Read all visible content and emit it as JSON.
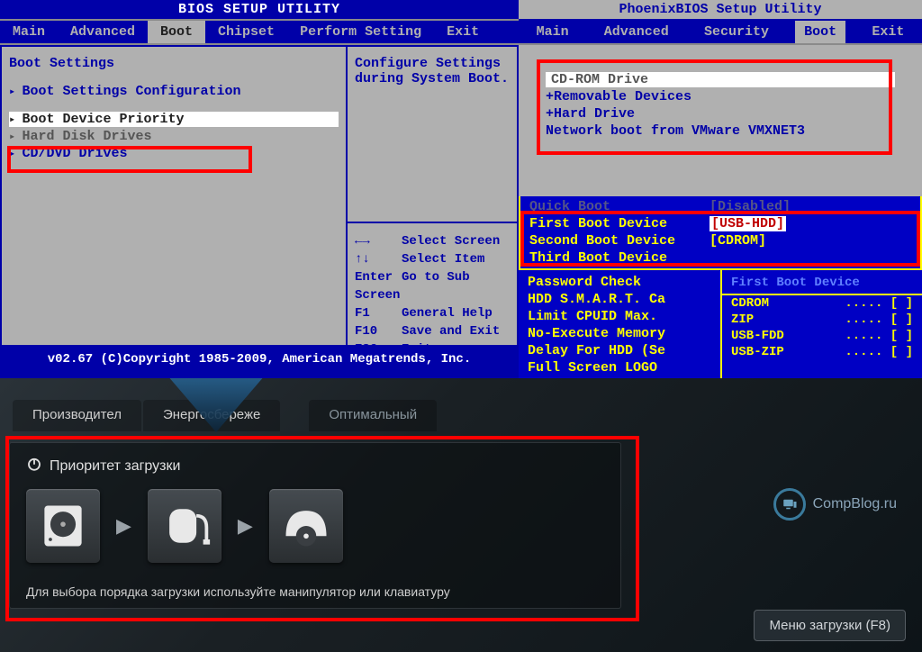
{
  "ami": {
    "title": "BIOS SETUP UTILITY",
    "menubar": [
      "Main",
      "Advanced",
      "Boot",
      "Chipset",
      "Perform Setting",
      "Exit"
    ],
    "selected_menu": 2,
    "panel_title": "Boot Settings",
    "items": [
      {
        "label": "Boot Settings Configuration",
        "sel": false
      },
      {
        "label": "Boot Device Priority",
        "sel": true
      },
      {
        "label": "Hard Disk Drives",
        "sel": false
      },
      {
        "label": "CD/DVD Drives",
        "sel": false
      }
    ],
    "right_desc_1": "Configure Settings",
    "right_desc_2": "during System Boot.",
    "help": [
      {
        "k": "←→",
        "v": "Select Screen"
      },
      {
        "k": "↑↓",
        "v": "Select Item"
      },
      {
        "k": "Enter",
        "v": "Go to Sub Screen"
      },
      {
        "k": "F1",
        "v": "General Help"
      },
      {
        "k": "F10",
        "v": "Save and Exit"
      },
      {
        "k": "ESC",
        "v": "Exit"
      }
    ],
    "footer": "v02.67 (C)Copyright 1985-2009, American Megatrends, Inc."
  },
  "phoenix": {
    "title": "PhoenixBIOS Setup Utility",
    "menubar": [
      "Main",
      "Advanced",
      "Security",
      "Boot",
      "Exit"
    ],
    "selected_menu": 3,
    "items": [
      {
        "label": "CD-ROM Drive",
        "sel": true
      },
      {
        "label": "+Removable Devices",
        "sel": false
      },
      {
        "label": "+Hard Drive",
        "sel": false
      },
      {
        "label": " Network boot from VMware VMXNET3",
        "sel": false
      }
    ]
  },
  "giga": {
    "top": [
      {
        "lbl": "Quick Boot",
        "val": "[Disabled]",
        "dim": true
      },
      {
        "lbl": "First Boot Device",
        "val": "[USB-HDD]",
        "sel": true
      },
      {
        "lbl": "Second Boot Device",
        "val": "[CDROM]"
      },
      {
        "lbl": "Third Boot Device",
        "val": ""
      }
    ],
    "left": [
      "Password Check",
      "HDD S.M.A.R.T. Ca",
      "Limit CPUID Max.",
      "No-Execute Memory",
      "Delay For HDD (Se",
      "Full Screen LOGO"
    ],
    "right_hdr": "First Boot Device",
    "right": [
      {
        "lbl": "CDROM",
        "v": "..... [ ]"
      },
      {
        "lbl": "ZIP",
        "v": "..... [ ]"
      },
      {
        "lbl": "USB-FDD",
        "v": "..... [ ]"
      },
      {
        "lbl": "USB-ZIP",
        "v": "..... [ ]"
      }
    ]
  },
  "asus": {
    "tabs": [
      "Производител",
      "Энергосбереже",
      "Оптимальный"
    ],
    "selected_tab": 2,
    "panel_title": "Приоритет загрузки",
    "hint": "Для выбора порядка загрузки используйте манипулятор или клавиатуру",
    "logo": "CompBlog.ru",
    "devices": [
      "hdd-icon",
      "mouse-icon",
      "optical-icon"
    ],
    "boot_menu_btn": "Меню загрузки (F8)"
  }
}
